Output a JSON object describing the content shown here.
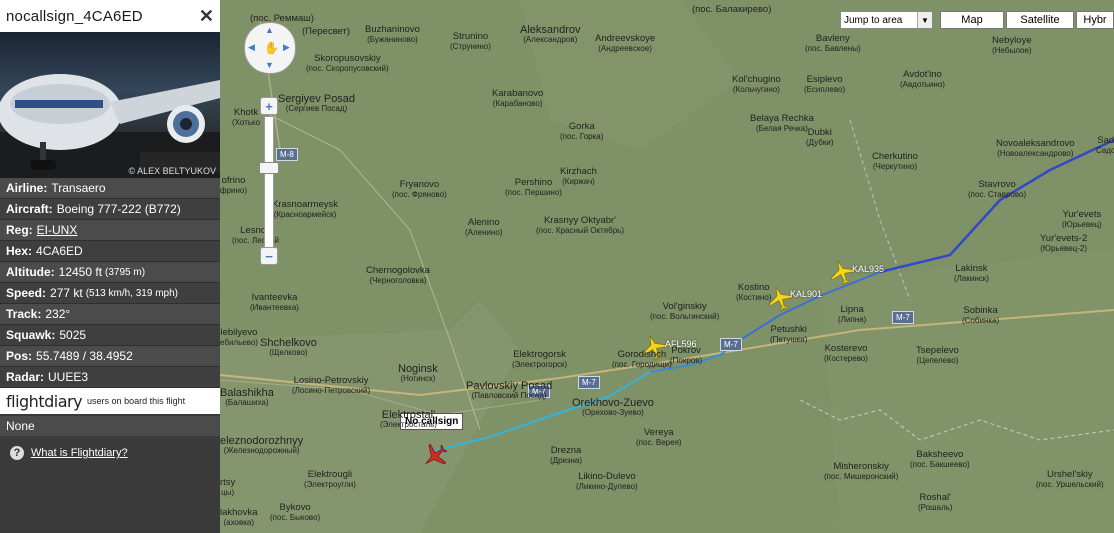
{
  "flight": {
    "title": "nocallsign_4CA6ED",
    "close": "✕",
    "photo_credit": "© ALEX BELTYUKOV"
  },
  "info": {
    "airline_k": "Airline:",
    "airline": "Transaero",
    "aircraft_k": "Aircraft:",
    "aircraft": "Boeing 777-222 (B772)",
    "reg_k": "Reg:",
    "reg": "EI-UNX",
    "hex_k": "Hex:",
    "hex": "4CA6ED",
    "alt_k": "Altitude:",
    "alt": "12450 ft",
    "alt_sm": "(3795 m)",
    "speed_k": "Speed:",
    "speed": "277 kt",
    "speed_sm": "(513 km/h, 319 mph)",
    "track_k": "Track:",
    "track": "232°",
    "squawk_k": "Squawk:",
    "squawk": "5025",
    "pos_k": "Pos:",
    "pos": "55.7489 / 38.4952",
    "radar_k": "Radar:",
    "radar": "UUEE3"
  },
  "flightdiary": {
    "logo": "flightdiary",
    "sub": "users on board this flight",
    "none": "None",
    "link": "What is Flightdiary?"
  },
  "map_controls": {
    "jump": "Jump to area",
    "map": "Map",
    "satellite": "Satellite",
    "hybrid": "Hybr"
  },
  "callout": "No callsign",
  "planes": [
    {
      "label": "KAL935"
    },
    {
      "label": "KAL901"
    },
    {
      "label": "AFL596"
    }
  ],
  "highways": [
    "M-8",
    "M-7",
    "M-7",
    "M-7",
    "M-7"
  ],
  "towns": [
    {
      "n": "(пос. Реммаш)",
      "r": ""
    },
    {
      "n": "(Пересвет)",
      "r": ""
    },
    {
      "n": "Buzhaninovo",
      "r": "(Бужаниново)"
    },
    {
      "n": "Strunino",
      "r": "(Струнино)"
    },
    {
      "n": "Aleksandrov",
      "r": "(Александров)"
    },
    {
      "n": "Andreevskoye",
      "r": "(Андреевское)"
    },
    {
      "n": "(пос. Балакирево)",
      "r": ""
    },
    {
      "n": "Bavleny",
      "r": "(пос. Бавлены)"
    },
    {
      "n": "Nebyloye",
      "r": "(Небылое)"
    },
    {
      "n": "Skoropusovskiy",
      "r": "(пос. Скоропусовский)"
    },
    {
      "n": "Kol'chugino",
      "r": "(Кольчугино)"
    },
    {
      "n": "Esiplevo",
      "r": "(Есиплево)"
    },
    {
      "n": "Avdot'ino",
      "r": "(Авдотьино)"
    },
    {
      "n": "Sergiyev Posad",
      "r": "(Сергиев Посад)"
    },
    {
      "n": "Khotk",
      "r": "(Хотько"
    },
    {
      "n": "Karabanovo",
      "r": "(Карабаново)"
    },
    {
      "n": "Belaya Rechka",
      "r": "(Белая Речка)"
    },
    {
      "n": "Dubki",
      "r": "(Дубки)"
    },
    {
      "n": "Gorka",
      "r": "(пос. Горка)"
    },
    {
      "n": "Novoaleksandrovo",
      "r": "(Новоалександрово)"
    },
    {
      "n": "Sad",
      "r": "Садо"
    },
    {
      "n": "Cherkutino",
      "r": "(Черкутино)"
    },
    {
      "n": "Kirzhach",
      "r": "(Киржач)"
    },
    {
      "n": "ofrino",
      "r": "фрино)"
    },
    {
      "n": "Fryanovo",
      "r": "(пос. Фряново)"
    },
    {
      "n": "Pershino",
      "r": "(пос. Першино)"
    },
    {
      "n": "Stavrovo",
      "r": "(пос. Ставрово)"
    },
    {
      "n": "Krasnoarmeysk",
      "r": "(Красноармейск)"
    },
    {
      "n": "Yur'evets",
      "r": "(Юрьевец)"
    },
    {
      "n": "Alenino",
      "r": "(Аленино)"
    },
    {
      "n": "Krasnyy Oktyabr'",
      "r": "(пос. Красный Октябрь)"
    },
    {
      "n": "Yur'evets-2",
      "r": "(Юрьевец-2)"
    },
    {
      "n": "Lesnoy",
      "r": "(пос. Лесной"
    },
    {
      "n": "Lakinsk",
      "r": "(Лакинск)"
    },
    {
      "n": "Chernogolovka",
      "r": "(Черноголовка)"
    },
    {
      "n": "Kostino",
      "r": "(Костино)"
    },
    {
      "n": "Ivanteevka",
      "r": "(Ивантеевка)"
    },
    {
      "n": "Sobinka",
      "r": "(Собинка)"
    },
    {
      "n": "Vol'ginskiy",
      "r": "(пос. Вольгинский)"
    },
    {
      "n": "Petushki",
      "r": "(Петушки)"
    },
    {
      "n": "Lipna",
      "r": "(Липна)"
    },
    {
      "n": "lebilyevo",
      "r": "ебильево)"
    },
    {
      "n": "Shchelkovo",
      "r": "(Щелково)"
    },
    {
      "n": "Gorodishch",
      "r": "(пос. Городищи)"
    },
    {
      "n": "Pokrov",
      "r": "(Покров)"
    },
    {
      "n": "Kosterevo",
      "r": "(Костерево)"
    },
    {
      "n": "Tsepelevo",
      "r": "(Цепелево)"
    },
    {
      "n": "Elektrogorsk",
      "r": "(Электрогорск)"
    },
    {
      "n": "Noginsk",
      "r": "(Ногинск)"
    },
    {
      "n": "Losino-Petrovskiy",
      "r": "(Лосино-Петровский)"
    },
    {
      "n": "Balashikha",
      "r": "(Балашиха)"
    },
    {
      "n": "Pavlovskiy Posad",
      "r": "(Павловский Посад)"
    },
    {
      "n": "Orekhovo-Zuevo",
      "r": "(Орехово-Зуево)"
    },
    {
      "n": "Elektrostal'",
      "r": "(Электросталь)"
    },
    {
      "n": "Vereya",
      "r": "(пос. Верея)"
    },
    {
      "n": "eleznodorozhnyy",
      "r": "(Железнодорожный)"
    },
    {
      "n": "Drezna",
      "r": "(Дрезна)"
    },
    {
      "n": "Baksheevo",
      "r": "(пос. Бакшеево)"
    },
    {
      "n": "Misheronskiy",
      "r": "(пос. Мишеронский)"
    },
    {
      "n": "Urshel'skiy",
      "r": "(пос. Уршельский)"
    },
    {
      "n": "Elektrougli",
      "r": "(Электроугли)"
    },
    {
      "n": "Likino-Dulevo",
      "r": "(Ликино-Дулево)"
    },
    {
      "n": "rtsy",
      "r": "цы)"
    },
    {
      "n": "Roshal'",
      "r": "(Рошаль)"
    },
    {
      "n": "Bykovo",
      "r": "(пос. Быково)"
    },
    {
      "n": "lakhovka",
      "r": "(аховка)"
    }
  ]
}
